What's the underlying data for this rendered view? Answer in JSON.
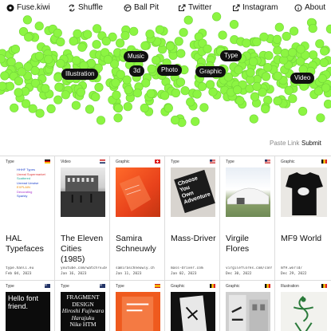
{
  "nav": {
    "logo": "Fuse.kiwi",
    "shuffle": "Shuffle",
    "ballpit": "Ball Pit",
    "twitter": "Twitter",
    "instagram": "Instagram",
    "about": "About"
  },
  "hero": {
    "tags": [
      "Illustration",
      "Music",
      "3d",
      "Photo",
      "Graphic",
      "Type",
      "Video"
    ],
    "paste_link": "Paste Link",
    "submit": "Submit",
    "ball_color": "#8cf542"
  },
  "cards": [
    {
      "type": "Type",
      "title": "HAL Typefaces",
      "url": "type.hanli.eu",
      "date": "Feb 04, 2023",
      "flag": "de",
      "thumb_lines": [
        "HHHF Types",
        "Unreal Supermarket",
        "Scattered",
        "Unread Unwise",
        "EXPLAIN",
        "Decorating",
        "Sparkly"
      ]
    },
    {
      "type": "Video",
      "title": "The Eleven Cities (1985)",
      "url": "youtube.com/watch?v=bv...",
      "date": "Jan 16, 2023",
      "flag": "nl"
    },
    {
      "type": "Graphic",
      "title": "Samira Schneuwly",
      "url": "samiraschneuwly.ch",
      "date": "Jan 11, 2023",
      "flag": "ch"
    },
    {
      "type": "Type",
      "title": "Mass-Driver",
      "url": "mass-driver.com",
      "date": "Jan 02, 2023",
      "flag": "us",
      "thumb_lines": [
        "Choose",
        "You",
        "Own",
        "Adventure"
      ]
    },
    {
      "type": "Type",
      "title": "Virgile Flores",
      "url": "virgileflores.com/conte...",
      "date": "Dec 30, 2022",
      "flag": "us"
    },
    {
      "type": "Graphic",
      "title": "MF9 World",
      "url": "mf9.world/",
      "date": "Dec 29, 2022",
      "flag": "be"
    },
    {
      "type": "Type",
      "flag": "au",
      "thumb_lines": [
        "Hello font",
        "friend."
      ]
    },
    {
      "type": "Type",
      "flag": "au",
      "thumb_lines": [
        "FRAGMENT",
        "DESIGN",
        "Hiroshi Fujiwara",
        "Harajuku",
        "Nike HTM"
      ]
    },
    {
      "type": "Type",
      "flag": "es"
    },
    {
      "type": "Graphic",
      "flag": "be"
    },
    {
      "type": "Graphic",
      "flag": "be"
    },
    {
      "type": "Illustration",
      "flag": "be"
    }
  ]
}
